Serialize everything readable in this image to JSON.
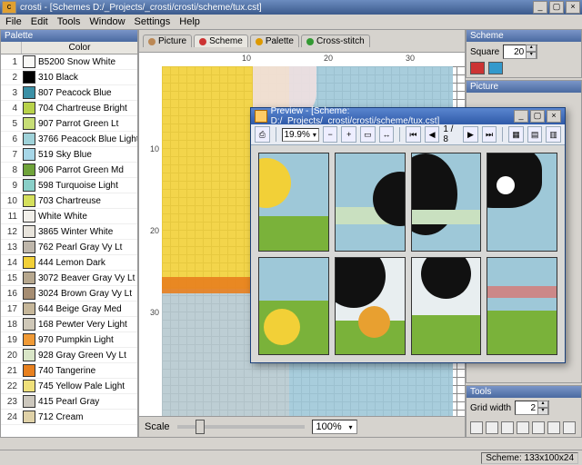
{
  "window": {
    "title": "crosti - [Schemes D:/_Projects/_crosti/crosti/scheme/tux.cst]"
  },
  "menu": [
    "File",
    "Edit",
    "Tools",
    "Window",
    "Settings",
    "Help"
  ],
  "palette_panel": {
    "title": "Palette",
    "header_color": "Color"
  },
  "palette": [
    {
      "n": "1",
      "c": "#f8f8f6",
      "l": "B5200 Snow White"
    },
    {
      "n": "2",
      "c": "#000000",
      "l": "310 Black"
    },
    {
      "n": "3",
      "c": "#3b90a6",
      "l": "807 Peacock Blue"
    },
    {
      "n": "4",
      "c": "#b8d24a",
      "l": "704 Chartreuse Bright"
    },
    {
      "n": "5",
      "c": "#c7de76",
      "l": "907 Parrot Green Lt"
    },
    {
      "n": "6",
      "c": "#9fd2d9",
      "l": "3766 Peacock Blue Light"
    },
    {
      "n": "7",
      "c": "#a7d7e8",
      "l": "519 Sky Blue"
    },
    {
      "n": "8",
      "c": "#6fa33a",
      "l": "906 Parrot Green Md"
    },
    {
      "n": "9",
      "c": "#89cfc8",
      "l": "598 Turquoise Light"
    },
    {
      "n": "10",
      "c": "#d5e05c",
      "l": "703 Chartreuse"
    },
    {
      "n": "11",
      "c": "#f2f0ea",
      "l": "White White"
    },
    {
      "n": "12",
      "c": "#e8e4dc",
      "l": "3865 Winter White"
    },
    {
      "n": "13",
      "c": "#bfb7ab",
      "l": "762 Pearl Gray Vy Lt"
    },
    {
      "n": "14",
      "c": "#f2d037",
      "l": "444 Lemon Dark"
    },
    {
      "n": "15",
      "c": "#b6a78e",
      "l": "3072 Beaver Gray Vy Lt"
    },
    {
      "n": "16",
      "c": "#a68d72",
      "l": "3024 Brown Gray Vy Lt"
    },
    {
      "n": "17",
      "c": "#c6b79a",
      "l": "644 Beige Gray Med"
    },
    {
      "n": "18",
      "c": "#cfc8b8",
      "l": "168 Pewter Very Light"
    },
    {
      "n": "19",
      "c": "#f09a36",
      "l": "970 Pumpkin Light"
    },
    {
      "n": "20",
      "c": "#d9e6c7",
      "l": "928 Gray Green Vy Lt"
    },
    {
      "n": "21",
      "c": "#e8801e",
      "l": "740 Tangerine"
    },
    {
      "n": "22",
      "c": "#efe07a",
      "l": "745 Yellow Pale Light"
    },
    {
      "n": "23",
      "c": "#ccc7bd",
      "l": "415 Pearl Gray"
    },
    {
      "n": "24",
      "c": "#e0d2a8",
      "l": "712 Cream"
    }
  ],
  "tabs": [
    {
      "icon": "#b85",
      "label": "Picture"
    },
    {
      "icon": "#c33",
      "label": "Scheme"
    },
    {
      "icon": "#d90",
      "label": "Palette"
    },
    {
      "icon": "#393",
      "label": "Cross-stitch"
    }
  ],
  "ruler": {
    "h": [
      "",
      "10",
      "20",
      "30"
    ],
    "v": [
      "",
      "10",
      "20",
      "30"
    ]
  },
  "scale": {
    "label": "Scale",
    "value": "100%"
  },
  "right": {
    "scheme": {
      "title": "Scheme",
      "square_label": "Square",
      "square_value": "20"
    },
    "picture": {
      "title": "Picture"
    },
    "tools": {
      "title": "Tools",
      "gridwidth_label": "Grid width",
      "gridwidth_value": "2"
    }
  },
  "status": {
    "text": "Scheme: 133x100x24"
  },
  "preview": {
    "title": "Preview - [Scheme: D:/_Projects/_crosti/crosti/scheme/tux.cst]",
    "zoom": "19.9%",
    "page": "1 / 8"
  }
}
